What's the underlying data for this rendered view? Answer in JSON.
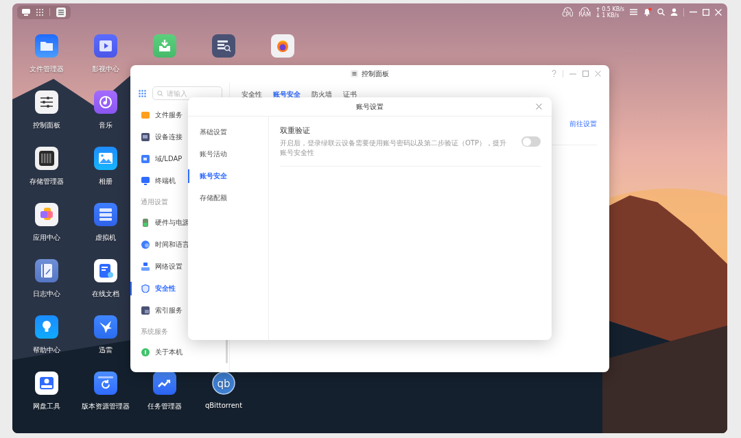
{
  "topbar": {
    "notification_dot": true,
    "cpu_label": "CPU",
    "ram_label": "RAM",
    "upload": "0.5 KB/s",
    "download": "1 KB/s"
  },
  "desktop_rows": [
    [
      {
        "kind": "files",
        "label": "文件管理器"
      },
      {
        "kind": "video",
        "label": "影视中心"
      },
      {
        "kind": "download"
      },
      {
        "kind": "server"
      },
      {
        "kind": "firefox"
      }
    ],
    [
      {
        "kind": "control",
        "label": "控制面板"
      },
      {
        "kind": "music",
        "label": "音乐"
      }
    ],
    [
      {
        "kind": "storage",
        "label": "存储管理器"
      },
      {
        "kind": "photos",
        "label": "相册"
      }
    ],
    [
      {
        "kind": "apps",
        "label": "应用中心"
      },
      {
        "kind": "vm",
        "label": "虚拟机"
      }
    ],
    [
      {
        "kind": "log",
        "label": "日志中心"
      },
      {
        "kind": "docs",
        "label": "在线文档"
      }
    ],
    [
      {
        "kind": "help",
        "label": "帮助中心"
      },
      {
        "kind": "bird",
        "label": "迅雷"
      }
    ],
    [
      {
        "kind": "disk",
        "label": "网盘工具"
      },
      {
        "kind": "version",
        "label": "版本资源管理器"
      },
      {
        "kind": "tasks",
        "label": "任务管理器"
      },
      {
        "kind": "qb",
        "mark": "qb",
        "label": "qBittorrent"
      }
    ]
  ],
  "control_panel": {
    "title": "控制面板",
    "search": {
      "placeholder": "请输入"
    },
    "sidebar": [
      {
        "kind": "item",
        "label": "文件服务",
        "selected": false
      },
      {
        "kind": "item",
        "label": "设备连接",
        "selected": false
      },
      {
        "kind": "item",
        "label": "域/LDAP",
        "selected": false
      },
      {
        "kind": "item",
        "label": "终端机",
        "selected": false
      },
      {
        "kind": "section",
        "label": "通用设置"
      },
      {
        "kind": "item",
        "label": "硬件与电源",
        "selected": false
      },
      {
        "kind": "item",
        "label": "时间和语言",
        "selected": false
      },
      {
        "kind": "item",
        "label": "网络设置",
        "selected": false
      },
      {
        "kind": "item",
        "label": "安全性",
        "selected": true
      },
      {
        "kind": "item",
        "label": "索引服务",
        "selected": false
      },
      {
        "kind": "section",
        "label": "系统服务"
      },
      {
        "kind": "item",
        "label": "关于本机",
        "selected": false
      }
    ],
    "tabs": [
      {
        "label": "安全性",
        "selected": false
      },
      {
        "label": "账号安全",
        "selected": true
      },
      {
        "label": "防火墙",
        "selected": false
      },
      {
        "label": "证书",
        "selected": false
      }
    ],
    "link": "前往设置"
  },
  "dialog": {
    "title": "账号设置",
    "nav": [
      {
        "label": "基础设置",
        "selected": false
      },
      {
        "label": "账号活动",
        "selected": false
      },
      {
        "label": "账号安全",
        "selected": true
      },
      {
        "label": "存储配额",
        "selected": false
      }
    ],
    "setting": {
      "title": "双重验证",
      "description": "开启后，登录绿联云设备需要使用账号密码以及第二步验证（OTP），提升账号安全性",
      "on": false
    }
  }
}
